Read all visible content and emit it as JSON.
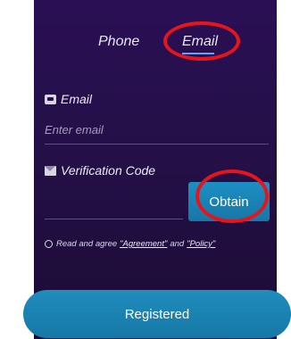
{
  "tabs": {
    "phone": "Phone",
    "email": "Email",
    "active": "Email"
  },
  "email_field": {
    "label": "Email",
    "placeholder": "Enter email",
    "value": "",
    "icon": "mailbox-icon"
  },
  "code_field": {
    "label": "Verification Code",
    "value": "",
    "icon": "envelope-icon"
  },
  "obtain_button": {
    "label": "Obtain"
  },
  "agreement": {
    "prefix": "Read and agree",
    "agreement_link": "\"Agreement\"",
    "conjunction": "and",
    "policy_link": "\"Policy\"",
    "checked": false
  },
  "submit_button": {
    "label": "Registered"
  },
  "colors": {
    "background": "#241047",
    "accent": "#1d8fc4",
    "annotation": "#e8141b"
  }
}
